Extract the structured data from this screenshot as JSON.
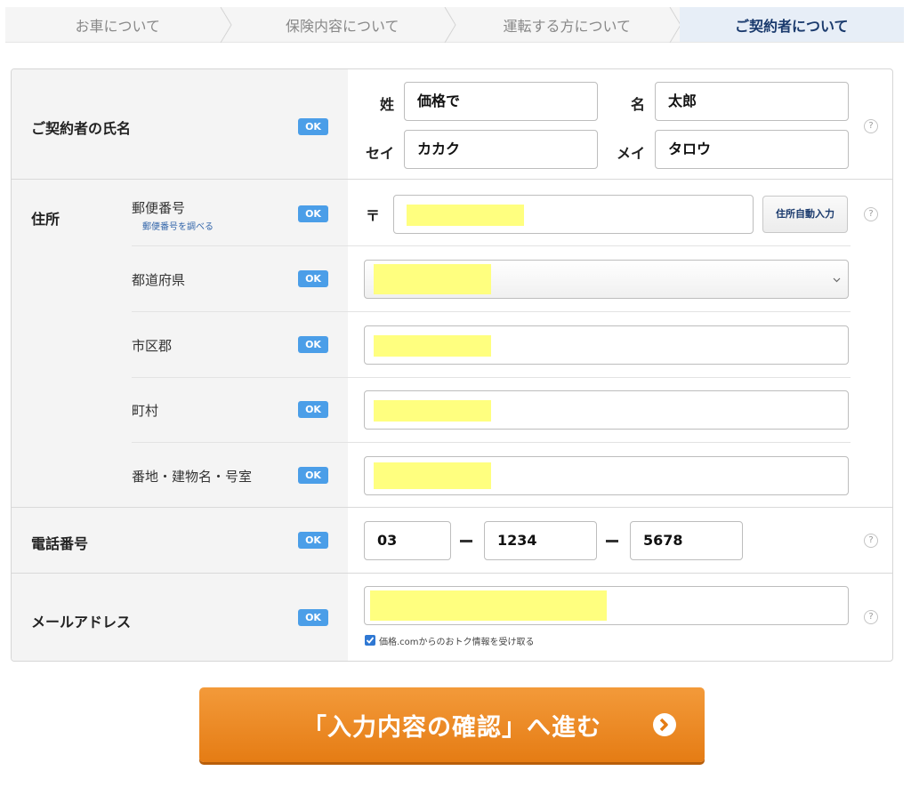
{
  "steps": [
    {
      "label": "お車について",
      "active": false
    },
    {
      "label": "保険内容について",
      "active": false
    },
    {
      "label": "運転する方について",
      "active": false
    },
    {
      "label": "ご契約者について",
      "active": true
    }
  ],
  "ok_label": "OK",
  "help_icon_text": "?",
  "name_section": {
    "label": "ご契約者の氏名",
    "sei_label": "姓",
    "sei_value": "価格で",
    "mei_label": "名",
    "mei_value": "太郎",
    "sei_kana_label": "セイ",
    "sei_kana_value": "カカク",
    "mei_kana_label": "メイ",
    "mei_kana_value": "タロウ"
  },
  "address_section": {
    "label": "住所",
    "postal_label": "郵便番号",
    "postal_link": "郵便番号を調べる",
    "postal_symbol": "〒",
    "auto_fill_button": "住所自動入力",
    "prefecture_label": "都道府県",
    "city_label": "市区郡",
    "town_label": "町村",
    "street_label": "番地・建物名・号室"
  },
  "phone_section": {
    "label": "電話番号",
    "part1": "03",
    "part2": "1234",
    "part3": "5678"
  },
  "email_section": {
    "label": "メールアドレス",
    "optin_text": "価格.comからのおトク情報を受け取る",
    "optin_checked": true
  },
  "submit": {
    "label": "「入力内容の確認」へ進む"
  },
  "colors": {
    "ok_badge": "#4b9ee8",
    "highlight": "#ffff7f",
    "submit": "#ec8a25",
    "active_step_text": "#1a3a6d"
  }
}
